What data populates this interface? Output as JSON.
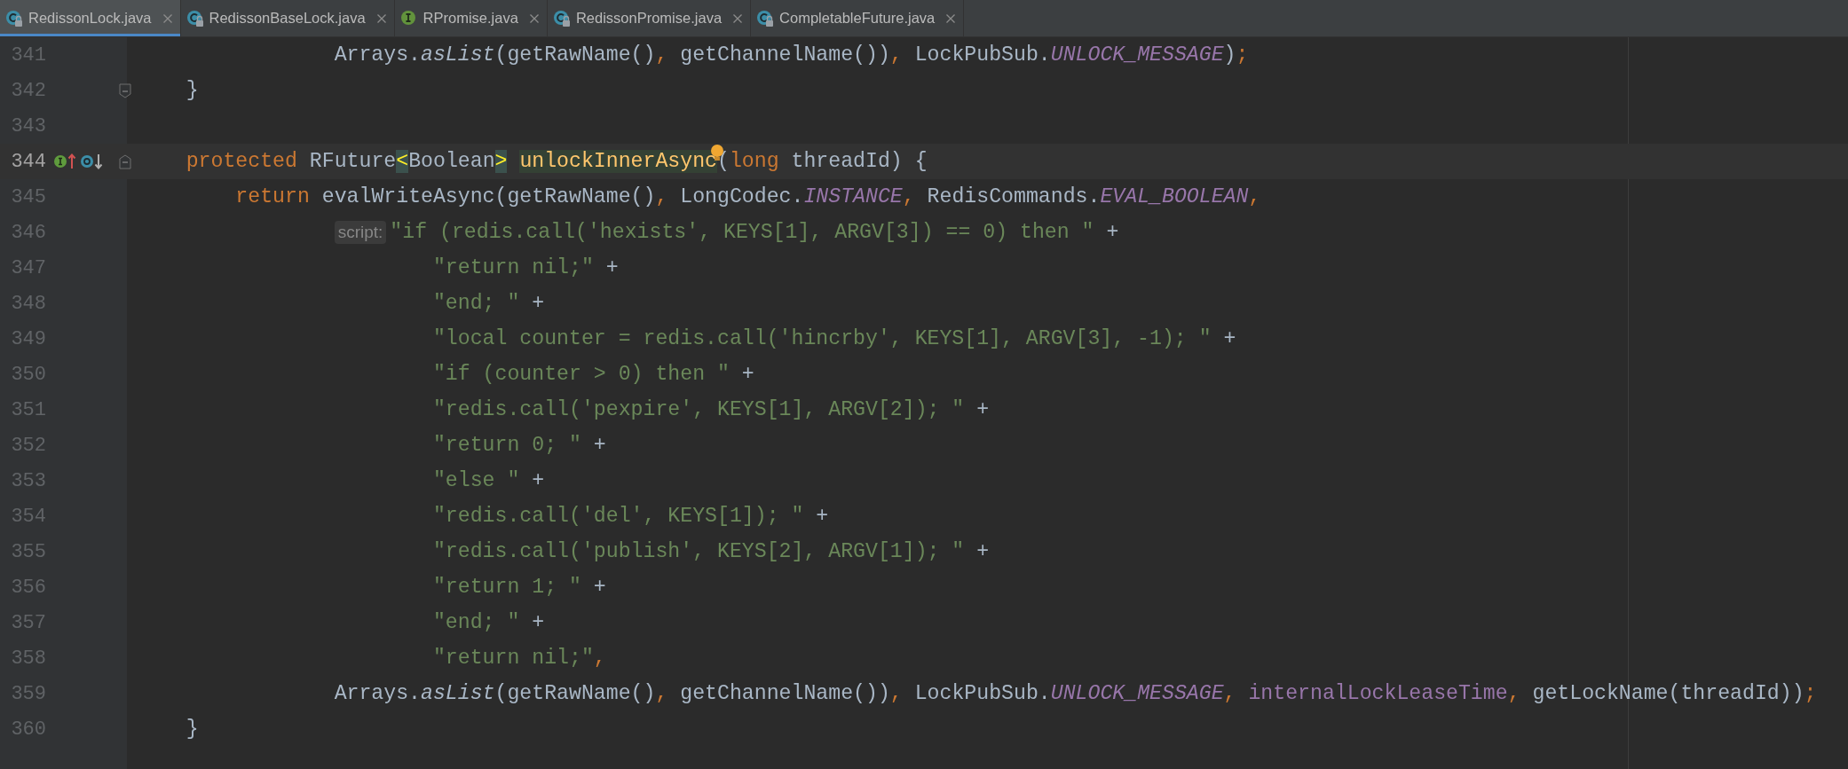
{
  "tabs": [
    {
      "label": "RedissonLock.java",
      "kind": "class",
      "selected": true
    },
    {
      "label": "RedissonBaseLock.java",
      "kind": "class",
      "selected": false
    },
    {
      "label": "RPromise.java",
      "kind": "interface",
      "selected": false
    },
    {
      "label": "RedissonPromise.java",
      "kind": "class",
      "selected": false
    },
    {
      "label": "CompletableFuture.java",
      "kind": "class",
      "selected": false
    }
  ],
  "lines": [
    {
      "number": "341",
      "current": false,
      "kind": "continuation",
      "tokens": [
        {
          "kind": "plain",
          "text": "Arrays."
        },
        {
          "kind": "static-call",
          "text": "asList"
        },
        {
          "kind": "plain",
          "text": "(getRawName()"
        },
        {
          "kind": "punct",
          "text": ", "
        },
        {
          "kind": "plain",
          "text": "getChannelName())"
        },
        {
          "kind": "punct",
          "text": ", "
        },
        {
          "kind": "plain",
          "text": "LockPubSub."
        },
        {
          "kind": "static",
          "text": "UNLOCK_MESSAGE"
        },
        {
          "kind": "plain",
          "text": ")"
        },
        {
          "kind": "punct",
          "text": ";"
        }
      ]
    },
    {
      "number": "342",
      "current": false,
      "kind": "member",
      "fold_marker": {
        "kind": "end"
      },
      "tokens": [
        {
          "kind": "plain",
          "text": "}"
        }
      ]
    },
    {
      "number": "343",
      "current": false
    },
    {
      "number": "344",
      "current": true,
      "kind": "member",
      "bulb": true,
      "fold_marker": {
        "kind": "start"
      },
      "gutter_marks": [
        {
          "kind": "implements"
        },
        {
          "kind": "overridden"
        }
      ],
      "tokens": [
        {
          "kind": "keyword",
          "text": "protected"
        },
        {
          "kind": "plain",
          "text": " RFuture"
        },
        {
          "kind": "bracket",
          "text": "<"
        },
        {
          "kind": "plain",
          "text": "Boolean"
        },
        {
          "kind": "bracket",
          "text": ">"
        },
        {
          "kind": "declaration",
          "text": "unlockInnerAsync"
        },
        {
          "kind": "plain",
          "text": "("
        },
        {
          "kind": "keyword",
          "text": "long"
        },
        {
          "kind": "plain",
          "text": " threadId) {"
        }
      ]
    },
    {
      "number": "345",
      "current": false,
      "kind": "body",
      "tokens": [
        {
          "kind": "keyword",
          "text": "return"
        },
        {
          "kind": "plain",
          "text": " evalWriteAsync(getRawName()"
        },
        {
          "kind": "punct",
          "text": ", "
        },
        {
          "kind": "plain",
          "text": "LongCodec."
        },
        {
          "kind": "static",
          "text": "INSTANCE"
        },
        {
          "kind": "punct",
          "text": ", "
        },
        {
          "kind": "plain",
          "text": "RedisCommands."
        },
        {
          "kind": "static",
          "text": "EVAL_BOOLEAN"
        },
        {
          "kind": "punct",
          "text": ","
        }
      ]
    },
    {
      "number": "346",
      "current": false,
      "kind": "continuation",
      "tokens": [
        {
          "kind": "hint",
          "text": "script:"
        },
        {
          "kind": "string",
          "text": "\"if (redis.call('hexists', KEYS[1], ARGV[3]) == 0) then \""
        },
        {
          "kind": "plain",
          "text": " +"
        }
      ]
    },
    {
      "number": "347",
      "current": false,
      "kind": "aligned",
      "tokens": [
        {
          "kind": "string",
          "text": "\"return nil;\""
        },
        {
          "kind": "plain",
          "text": " +"
        }
      ]
    },
    {
      "number": "348",
      "current": false,
      "kind": "aligned",
      "tokens": [
        {
          "kind": "string",
          "text": "\"end; \""
        },
        {
          "kind": "plain",
          "text": " +"
        }
      ]
    },
    {
      "number": "349",
      "current": false,
      "kind": "aligned",
      "tokens": [
        {
          "kind": "string",
          "text": "\"local counter = redis.call('hincrby', KEYS[1], ARGV[3], -1); \""
        },
        {
          "kind": "plain",
          "text": " +"
        }
      ]
    },
    {
      "number": "350",
      "current": false,
      "kind": "aligned",
      "tokens": [
        {
          "kind": "string",
          "text": "\"if (counter > 0) then \""
        },
        {
          "kind": "plain",
          "text": " +"
        }
      ]
    },
    {
      "number": "351",
      "current": false,
      "kind": "aligned",
      "tokens": [
        {
          "kind": "string",
          "text": "\"redis.call('pexpire', KEYS[1], ARGV[2]); \""
        },
        {
          "kind": "plain",
          "text": " +"
        }
      ]
    },
    {
      "number": "352",
      "current": false,
      "kind": "aligned",
      "tokens": [
        {
          "kind": "string",
          "text": "\"return 0; \""
        },
        {
          "kind": "plain",
          "text": " +"
        }
      ]
    },
    {
      "number": "353",
      "current": false,
      "kind": "aligned",
      "tokens": [
        {
          "kind": "string",
          "text": "\"else \""
        },
        {
          "kind": "plain",
          "text": " +"
        }
      ]
    },
    {
      "number": "354",
      "current": false,
      "kind": "aligned",
      "tokens": [
        {
          "kind": "string",
          "text": "\"redis.call('del', KEYS[1]); \""
        },
        {
          "kind": "plain",
          "text": " +"
        }
      ]
    },
    {
      "number": "355",
      "current": false,
      "kind": "aligned",
      "tokens": [
        {
          "kind": "string",
          "text": "\"redis.call('publish', KEYS[2], ARGV[1]); \""
        },
        {
          "kind": "plain",
          "text": " +"
        }
      ]
    },
    {
      "number": "356",
      "current": false,
      "kind": "aligned",
      "tokens": [
        {
          "kind": "string",
          "text": "\"return 1; \""
        },
        {
          "kind": "plain",
          "text": " +"
        }
      ]
    },
    {
      "number": "357",
      "current": false,
      "kind": "aligned",
      "tokens": [
        {
          "kind": "string",
          "text": "\"end; \""
        },
        {
          "kind": "plain",
          "text": " +"
        }
      ]
    },
    {
      "number": "358",
      "current": false,
      "kind": "aligned",
      "tokens": [
        {
          "kind": "string",
          "text": "\"return nil;\""
        },
        {
          "kind": "punct",
          "text": ","
        }
      ]
    },
    {
      "number": "359",
      "current": false,
      "kind": "continuation",
      "tokens": [
        {
          "kind": "plain",
          "text": "Arrays."
        },
        {
          "kind": "static-call",
          "text": "asList"
        },
        {
          "kind": "plain",
          "text": "(getRawName()"
        },
        {
          "kind": "punct",
          "text": ", "
        },
        {
          "kind": "plain",
          "text": "getChannelName())"
        },
        {
          "kind": "punct",
          "text": ", "
        },
        {
          "kind": "plain",
          "text": "LockPubSub."
        },
        {
          "kind": "static",
          "text": "UNLOCK_MESSAGE"
        },
        {
          "kind": "punct",
          "text": ", "
        },
        {
          "kind": "field",
          "text": "internalLockLeaseTime"
        },
        {
          "kind": "punct",
          "text": ", "
        },
        {
          "kind": "plain",
          "text": "getLockName(threadId))"
        },
        {
          "kind": "punct",
          "text": ";"
        }
      ]
    },
    {
      "number": "360",
      "current": false,
      "kind": "member",
      "tokens": [
        {
          "kind": "plain",
          "text": "}"
        }
      ]
    }
  ]
}
